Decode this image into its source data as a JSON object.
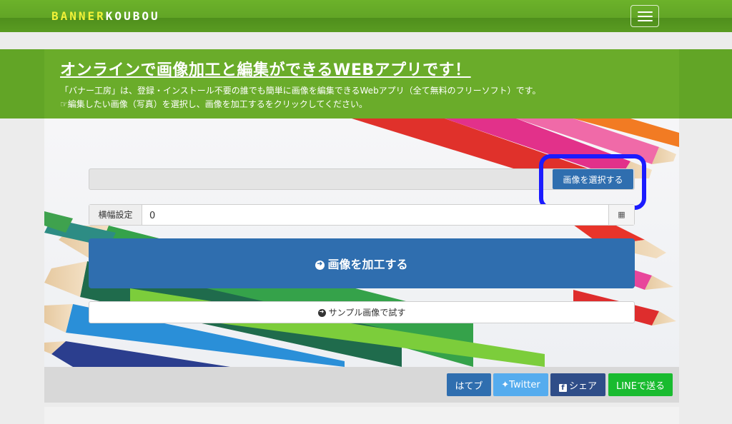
{
  "navbar": {
    "logo_part1": "BANNER",
    "logo_part2": "KOUBOU",
    "menu_icon": "hamburger-icon"
  },
  "hero": {
    "headline": "オンラインで画像加工と編集ができるWEBアプリです！",
    "description_line1": "「バナー工房」は、登録・インストール不要の誰でも簡単に画像を編集できるWebアプリ（全て無料のフリーソフト）です。",
    "description_line2": "☞編集したい画像（写真）を選択し、画像を加工するをクリックしてください。"
  },
  "form": {
    "file_value": "",
    "select_button": "画像を選択する",
    "width_label": "横幅設定",
    "width_value": "0",
    "width_icon": "calculator-icon",
    "process_button": "画像を加工する",
    "sample_button": "サンプル画像で試す"
  },
  "share": {
    "hatena": "はてブ",
    "twitter": "Twitter",
    "facebook": "シェア",
    "line": "LINEで送る"
  },
  "colors": {
    "brand_green": "#62a526",
    "primary_blue": "#2f6eaf",
    "highlight_blue": "#1b1bff",
    "twitter_blue": "#55acee",
    "facebook_navy": "#2f4d88",
    "line_green": "#19bb2f"
  }
}
